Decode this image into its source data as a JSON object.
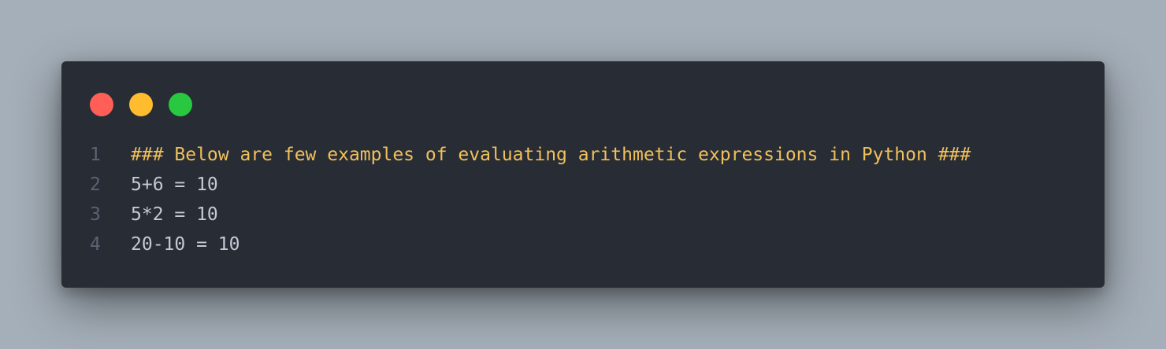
{
  "colors": {
    "background": "#a5afb9",
    "window": "#282c35",
    "close": "#ff5f57",
    "minimize": "#febc2e",
    "maximize": "#28c840",
    "comment": "#f0c05a",
    "code_text": "#c3cad6",
    "line_number": "#5b6373"
  },
  "code": {
    "lines": [
      {
        "number": "1",
        "text": "### Below are few examples of evaluating arithmetic expressions in Python ###"
      },
      {
        "number": "2",
        "text": "5+6 = 10"
      },
      {
        "number": "3",
        "text": "5*2 = 10"
      },
      {
        "number": "4",
        "text": "20-10 = 10"
      }
    ]
  }
}
